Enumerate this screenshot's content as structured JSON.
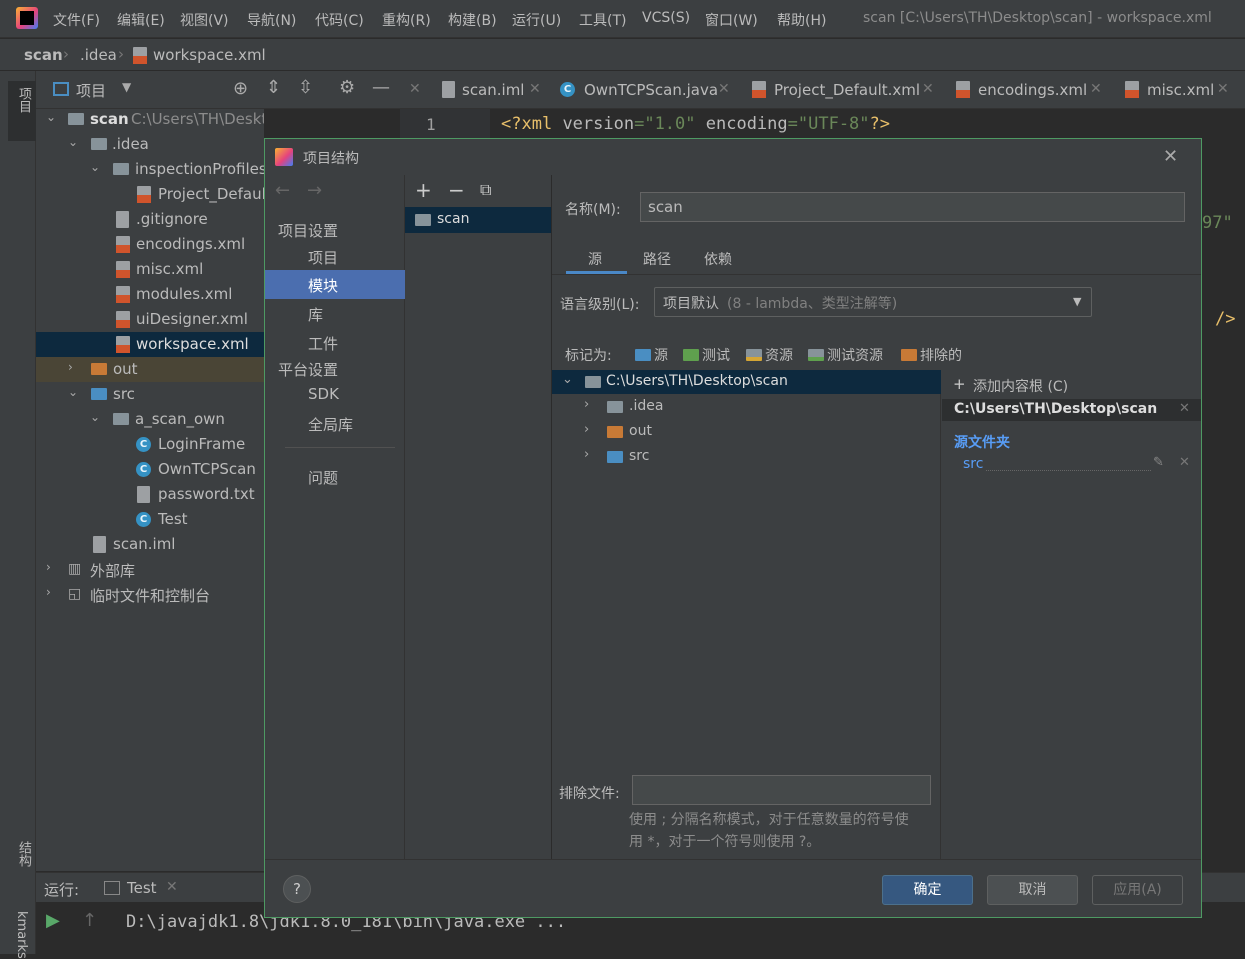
{
  "menubar": {
    "items": [
      "文件(F)",
      "编辑(E)",
      "视图(V)",
      "导航(N)",
      "代码(C)",
      "重构(R)",
      "构建(B)",
      "运行(U)",
      "工具(T)",
      "VCS(S)",
      "窗口(W)",
      "帮助(H)"
    ],
    "window_title": "scan [C:\\Users\\TH\\Desktop\\scan] - workspace.xml"
  },
  "breadcrumb": [
    "scan",
    ".idea",
    "workspace.xml"
  ],
  "left_strip": {
    "project_label": "项目",
    "structure_label": "结构",
    "bookmarks_label": "kmarks"
  },
  "project_panel": {
    "title": "项目",
    "root_name": "scan",
    "root_path": "C:\\Users\\TH\\Desktop\\scan",
    "tree": [
      ".idea",
      "inspectionProfiles",
      "Project_Defaul",
      ".gitignore",
      "encodings.xml",
      "misc.xml",
      "modules.xml",
      "uiDesigner.xml",
      "workspace.xml",
      "out",
      "src",
      "a_scan_own",
      "LoginFrame",
      "OwnTCPScan",
      "password.txt",
      "Test",
      "scan.iml",
      "外部库",
      "临时文件和控制台"
    ]
  },
  "editor": {
    "tabs": [
      "scan.iml",
      "OwnTCPScan.java",
      "Project_Default.xml",
      "encodings.xml",
      "misc.xml"
    ],
    "line1_number": "1",
    "code_partial_1": "97\" r",
    "code_partial_2": "/>"
  },
  "run_panel": {
    "label": "运行:",
    "tab": "Test",
    "output": "D:\\javajdk1.8\\jdk1.8.0_181\\bin\\java.exe ..."
  },
  "dialog": {
    "title": "项目结构",
    "nav": {
      "section_project": "项目设置",
      "project": "项目",
      "modules": "模块",
      "libraries": "库",
      "facets": "工件",
      "section_platform": "平台设置",
      "sdk": "SDK",
      "global_libs": "全局库",
      "problems": "问题"
    },
    "module_list": [
      "scan"
    ],
    "name_label": "名称(M):",
    "name_value": "scan",
    "tabs": [
      "源",
      "路径",
      "依赖"
    ],
    "lang_level_label": "语言级别(L):",
    "lang_level_value": "项目默认",
    "lang_level_detail": "(8 - lambda、类型注解等)",
    "mark_as_label": "标记为:",
    "mark_as": [
      "源",
      "测试",
      "资源",
      "测试资源",
      "排除的"
    ],
    "content_tree": [
      "C:\\Users\\TH\\Desktop\\scan",
      ".idea",
      "out",
      "src"
    ],
    "add_content_root": "添加内容根 (C)",
    "content_root_path": "C:\\Users\\TH\\Desktop\\scan",
    "source_folders_title": "源文件夹",
    "source_folder": "src",
    "exclude_label": "排除文件:",
    "exclude_value": "",
    "exclude_hint_line1": "使用 ; 分隔名称模式，对于任意数量的符号使",
    "exclude_hint_line2": "用 *，对于一个符号则使用 ?。",
    "help": "?",
    "ok": "确定",
    "cancel": "取消",
    "apply": "应用(A)"
  },
  "colors": {
    "accent": "#4b6eaf",
    "dialog_border": "#4e9a63",
    "source_blue": "#589df6",
    "folder_orange": "#c87a36"
  }
}
